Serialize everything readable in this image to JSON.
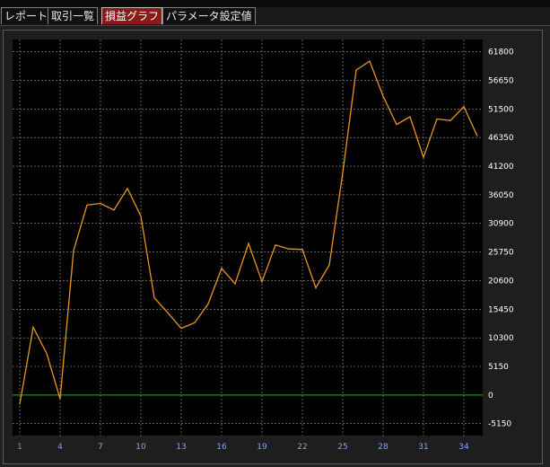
{
  "tabs": [
    {
      "label": "レポート",
      "active": false
    },
    {
      "label": "取引一覧",
      "active": false
    },
    {
      "label": "損益グラフ",
      "active": true
    },
    {
      "label": "パラメータ設定値",
      "active": false
    }
  ],
  "colors": {
    "background": "#000000",
    "line": "#e8961e",
    "zero_line": "#00c800",
    "grid": "#a0a0a0",
    "active_tab": "#8b1a1a"
  },
  "chart_data": {
    "type": "line",
    "title": "",
    "xlabel": "",
    "ylabel": "",
    "grid": true,
    "xlim": [
      1,
      35
    ],
    "ylim": [
      -7300,
      64000
    ],
    "x_ticks": [
      "1",
      "4",
      "7",
      "10",
      "13",
      "16",
      "19",
      "22",
      "25",
      "28",
      "31",
      "34"
    ],
    "y_ticks": [
      "61800",
      "56650",
      "51500",
      "46350",
      "41200",
      "36050",
      "30900",
      "25750",
      "20600",
      "15450",
      "10300",
      "5150",
      "0",
      "-5150"
    ],
    "series": [
      {
        "x": [
          1,
          2,
          3,
          4,
          5,
          6,
          7,
          8,
          9,
          10,
          11,
          12,
          13,
          14,
          15,
          16,
          17,
          18,
          19,
          20,
          21,
          22,
          23,
          24,
          25,
          26,
          27,
          28,
          29,
          30,
          31,
          32,
          33,
          34,
          35
        ],
        "values": [
          -1700,
          12200,
          7500,
          -700,
          26000,
          34200,
          34500,
          33300,
          37200,
          32200,
          17500,
          14800,
          12000,
          13000,
          16400,
          22800,
          20000,
          27300,
          20400,
          27000,
          26300,
          26200,
          19300,
          23400,
          40000,
          58500,
          60100,
          53800,
          48700,
          50100,
          42800,
          49700,
          49400,
          51900,
          46600
        ]
      }
    ]
  }
}
